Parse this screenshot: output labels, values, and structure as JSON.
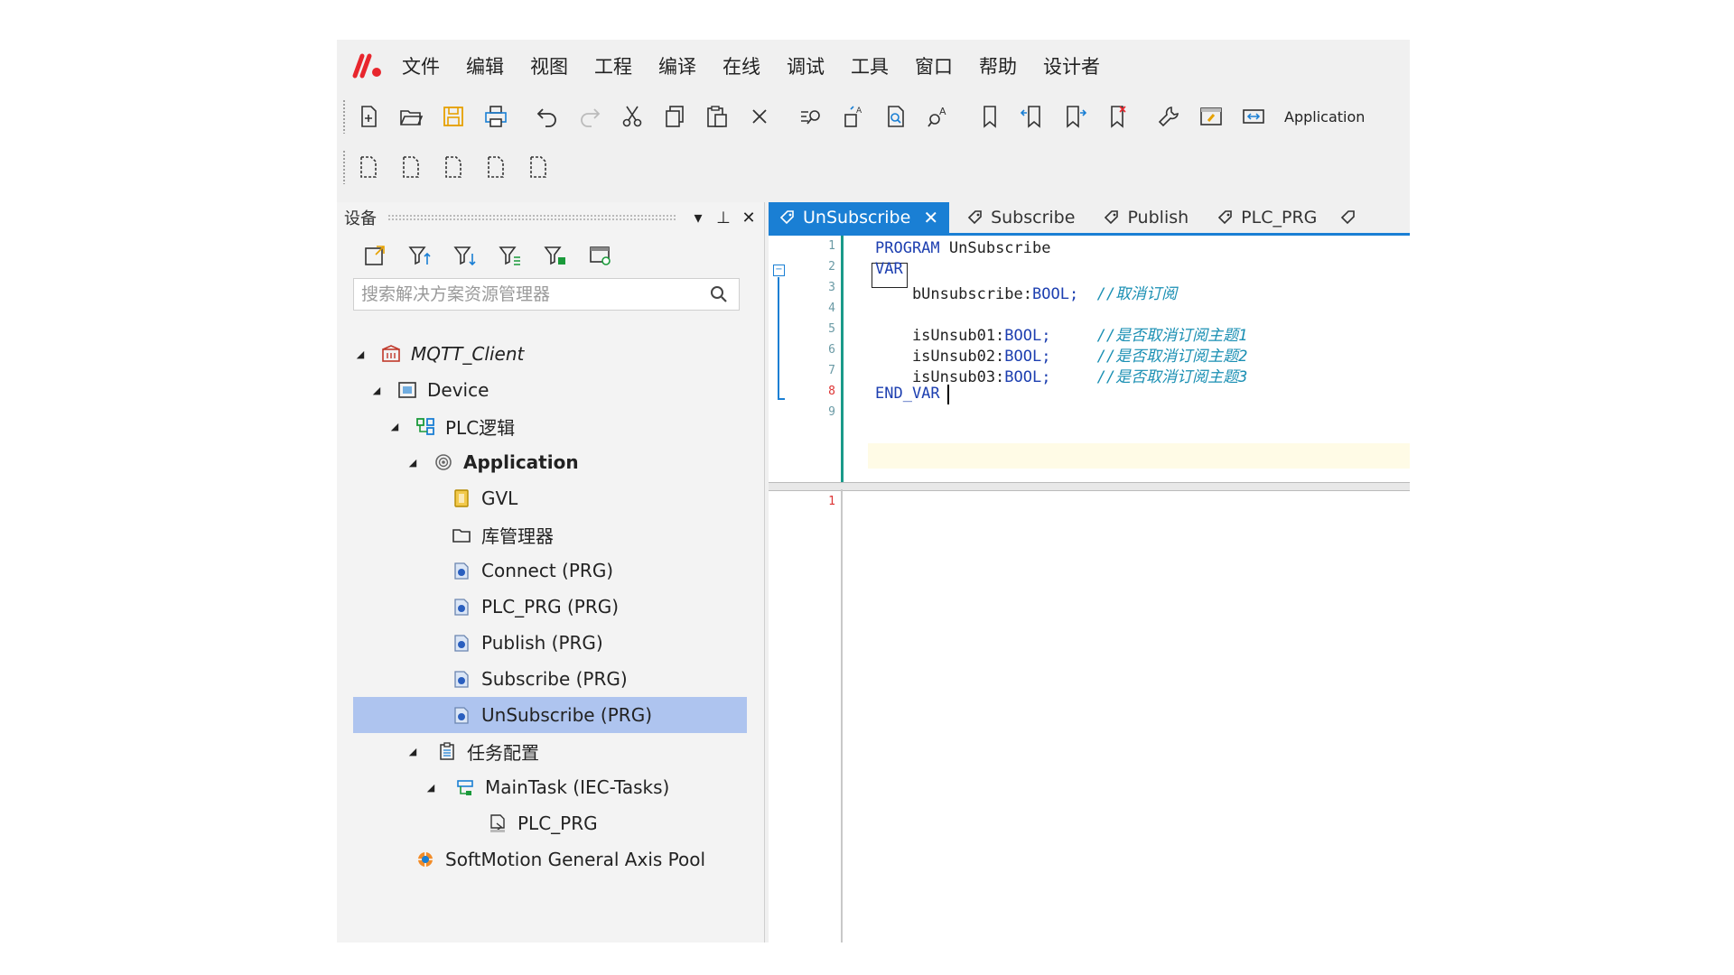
{
  "menu": {
    "items": [
      "文件",
      "编辑",
      "视图",
      "工程",
      "编译",
      "在线",
      "调试",
      "工具",
      "窗口",
      "帮助",
      "设计者"
    ]
  },
  "toolbar": {
    "app_label": "Application"
  },
  "devices_panel": {
    "title": "设备",
    "pin_glyph": "⊥",
    "close_glyph": "✕",
    "dropdown_glyph": "▾",
    "search_placeholder": "搜索解决方案资源管理器",
    "tree": [
      {
        "label": "MQTT_Client",
        "icon": "project-icon",
        "expander": "◢"
      },
      {
        "label": "Device",
        "icon": "device-icon",
        "expander": "◢"
      },
      {
        "label": "PLC逻辑",
        "icon": "plc-logic-icon",
        "expander": "◢"
      },
      {
        "label": "Application",
        "icon": "application-icon",
        "expander": "◢"
      },
      {
        "label": "GVL",
        "icon": "gvl-icon",
        "expander": ""
      },
      {
        "label": "库管理器",
        "icon": "library-manager-icon",
        "expander": ""
      },
      {
        "label": "Connect (PRG)",
        "icon": "program-icon",
        "expander": ""
      },
      {
        "label": "PLC_PRG (PRG)",
        "icon": "program-icon",
        "expander": ""
      },
      {
        "label": "Publish (PRG)",
        "icon": "program-icon",
        "expander": ""
      },
      {
        "label": "Subscribe (PRG)",
        "icon": "program-icon",
        "expander": ""
      },
      {
        "label": "UnSubscribe (PRG)",
        "icon": "program-icon",
        "expander": ""
      },
      {
        "label": "任务配置",
        "icon": "task-config-icon",
        "expander": "◢"
      },
      {
        "label": "MainTask (IEC-Tasks)",
        "icon": "task-icon",
        "expander": "◢"
      },
      {
        "label": "PLC_PRG",
        "icon": "program-call-icon",
        "expander": ""
      },
      {
        "label": "SoftMotion General Axis Pool",
        "icon": "axis-pool-icon",
        "expander": ""
      }
    ]
  },
  "editor": {
    "tabs": [
      {
        "label": "UnSubscribe",
        "active": true,
        "close": "✕"
      },
      {
        "label": "Subscribe",
        "active": false
      },
      {
        "label": "Publish",
        "active": false
      },
      {
        "label": "PLC_PRG",
        "active": false
      }
    ],
    "line_numbers": [
      "1",
      "2",
      "3",
      "4",
      "5",
      "6",
      "7",
      "8",
      "9"
    ],
    "code": {
      "l1_kw": "PROGRAM",
      "l1_name": " UnSubscribe",
      "l2_kw": "VAR",
      "l3_var": "    bUnsubscribe:",
      "l3_type": "BOOL;",
      "l3_comment": "  //取消订阅",
      "l5_var": "    isUnsub01:",
      "l5_type": "BOOL;",
      "l5_comment": "     //是否取消订阅主题1",
      "l6_var": "    isUnsub02:",
      "l6_type": "BOOL;",
      "l6_comment": "     //是否取消订阅主题2",
      "l7_var": "    isUnsub03:",
      "l7_type": "BOOL;",
      "l7_comment": "     //是否取消订阅主题3",
      "l8_kw": "END_VAR"
    },
    "impl_line_number": "1"
  },
  "colors": {
    "accent": "#1a7fd4",
    "selection": "#aec4ef",
    "keyword": "#1d3fb0",
    "comment": "#1a8fb3",
    "logo": "#e8262d"
  }
}
